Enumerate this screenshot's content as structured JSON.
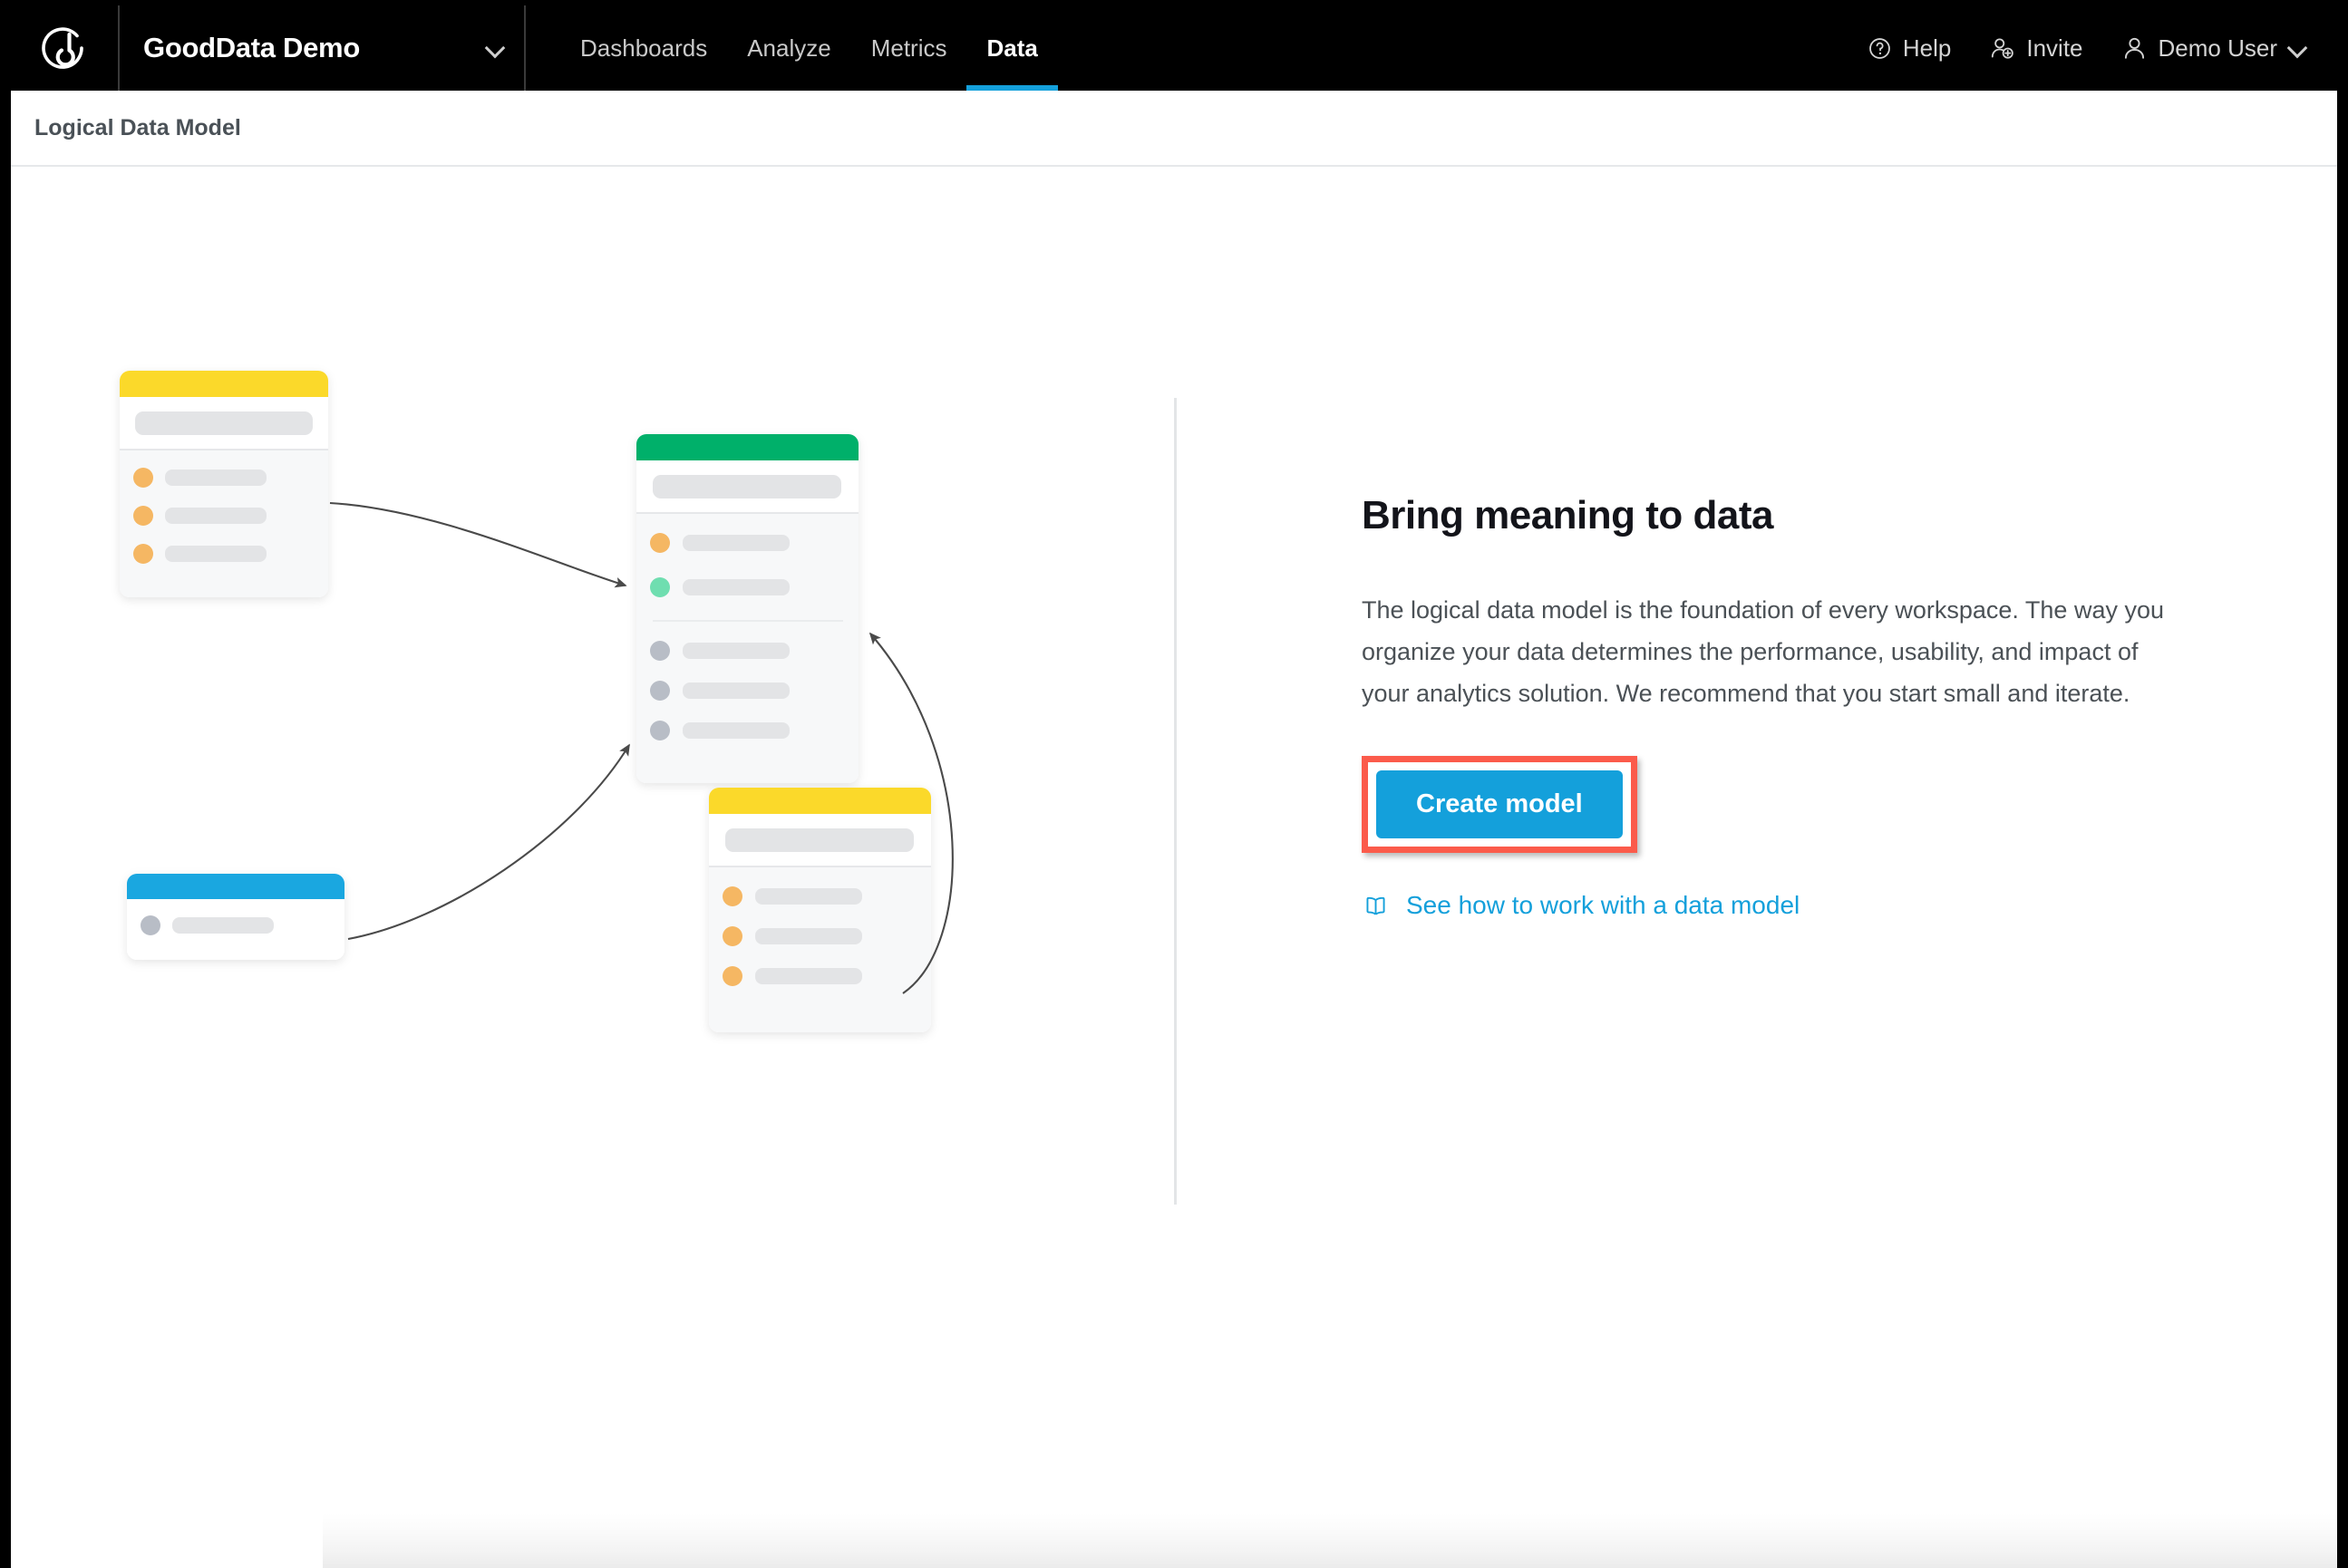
{
  "app": {
    "logo_icon": "gooddata-logo-icon",
    "workspace_name": "GoodData Demo",
    "workspace_chevron_icon": "chevron-down-icon"
  },
  "nav": {
    "tabs": [
      {
        "label": "Dashboards",
        "active": false
      },
      {
        "label": "Analyze",
        "active": false
      },
      {
        "label": "Metrics",
        "active": false
      },
      {
        "label": "Data",
        "active": true
      }
    ]
  },
  "user_menu": {
    "help_label": "Help",
    "help_icon": "question-circle-icon",
    "invite_label": "Invite",
    "invite_icon": "user-plus-icon",
    "user_label": "Demo User",
    "user_icon": "user-icon",
    "user_chevron_icon": "chevron-down-icon"
  },
  "breadcrumb": {
    "title": "Logical Data Model"
  },
  "panel": {
    "title": "Bring meaning to data",
    "body": "The logical data model is the foundation of every workspace. The way you organize your data determines the performance, usability, and impact of your analytics solution. We recommend that you start small and iterate.",
    "primary_button": "Create model",
    "doc_link_label": "See how to work with a data model",
    "doc_link_icon": "open-book-icon"
  },
  "colors": {
    "topbar_background": "#000000",
    "accent_blue": "#14a0db",
    "highlight_red": "#fb5b4b",
    "card_yellow": "#fbd92a",
    "card_green": "#00b06a",
    "card_blue": "#1aa7e0",
    "attribute_orange": "#f5b763",
    "fact_green": "#6fdeb0",
    "date_gray": "#b8bdc6",
    "text_dark": "#13141a",
    "text_body": "#4b5156",
    "divider": "#e3e5e7"
  },
  "illustration": {
    "name": "logical-data-model-illustration",
    "cards": [
      {
        "id": "card-yellow-top-left",
        "header_color": "#fbd92a",
        "rows": [
          {
            "dot_color": "#f5b763"
          },
          {
            "dot_color": "#f5b763"
          },
          {
            "dot_color": "#f5b763"
          }
        ]
      },
      {
        "id": "card-green-center",
        "header_color": "#00b06a",
        "rows": [
          {
            "dot_color": "#f5b763"
          },
          {
            "dot_color": "#6fdeb0"
          },
          {
            "dot_color": "#b8bdc6"
          },
          {
            "dot_color": "#b8bdc6"
          },
          {
            "dot_color": "#b8bdc6"
          }
        ]
      },
      {
        "id": "card-yellow-bottom-right",
        "header_color": "#fbd92a",
        "rows": [
          {
            "dot_color": "#f5b763"
          },
          {
            "dot_color": "#f5b763"
          },
          {
            "dot_color": "#f5b763"
          }
        ]
      },
      {
        "id": "card-blue-bottom-left",
        "header_color": "#1aa7e0",
        "rows": [
          {
            "dot_color": "#b8bdc6"
          }
        ]
      }
    ],
    "connections": [
      {
        "from": "card-yellow-top-left",
        "to": "card-green-center"
      },
      {
        "from": "card-blue-bottom-left",
        "to": "card-green-center"
      },
      {
        "from": "card-yellow-bottom-right",
        "to": "card-green-center"
      }
    ]
  }
}
